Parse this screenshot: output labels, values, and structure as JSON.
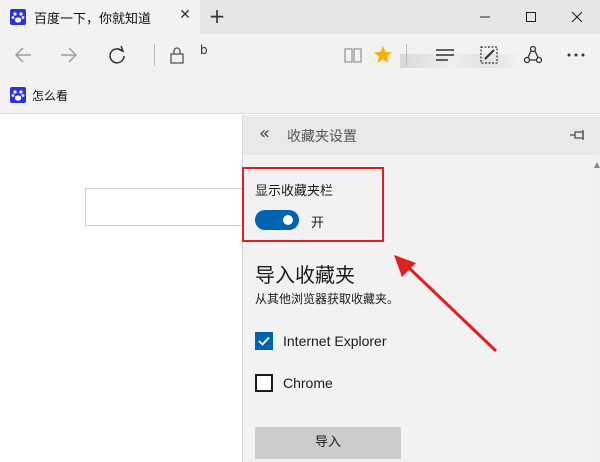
{
  "browser": {
    "tab": {
      "title": "百度一下，你就知道",
      "favicon_icon": "baidu-paw-icon",
      "close_icon": "close-icon"
    },
    "new_tab_label": "+",
    "window_controls": [
      "minimize-icon",
      "maximize-icon",
      "close-icon"
    ],
    "nav": {
      "icons": [
        "back-arrow-icon",
        "forward-arrow-icon",
        "refresh-icon",
        "lock-icon",
        "reading-view-icon",
        "favorite-star-icon",
        "hub-icon",
        "web-note-icon",
        "share-icon",
        "more-icon"
      ],
      "address_partial": "b"
    },
    "favorites_bar": {
      "items": [
        {
          "label": "怎么看",
          "icon": "baidu-paw-icon"
        }
      ]
    }
  },
  "panel": {
    "title": "收藏夹设置",
    "back_icon": "double-chevron-left-icon",
    "pin_icon": "pin-icon",
    "show_favorites_bar": {
      "label": "显示收藏夹栏",
      "state_label": "开",
      "on": true
    },
    "import": {
      "title": "导入收藏夹",
      "description": "从其他浏览器获取收藏夹。",
      "browsers": [
        {
          "label": "Internet Explorer",
          "checked": true
        },
        {
          "label": "Chrome",
          "checked": false
        }
      ],
      "button_label": "导入"
    }
  },
  "colors": {
    "accent": "#0063b1",
    "annotation": "#e02020",
    "star": "#f4b400"
  }
}
